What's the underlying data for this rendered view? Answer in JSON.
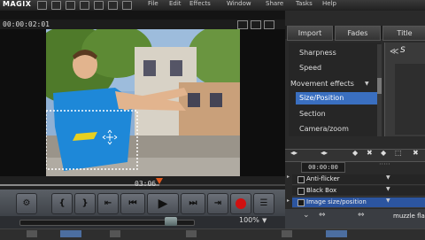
{
  "app": {
    "logo": "MAGIX"
  },
  "menu": [
    "File",
    "Edit",
    "Effects",
    "Window",
    "Share",
    "Tasks",
    "Help"
  ],
  "player": {
    "timecode": "00:00:02:01",
    "scrub_time": "03:06",
    "zoom": "100%",
    "progress": 0.56,
    "volume": 0.87
  },
  "transport": {
    "buttons": [
      "{",
      "}",
      "⇤",
      "⏮",
      "▶",
      "⏭",
      "⇥",
      "●",
      "☰"
    ]
  },
  "panel": {
    "tabs": [
      "Import",
      "Fades",
      "Title"
    ],
    "list": [
      "Sharpness",
      "Speed",
      "Movement effects",
      "Size/Position",
      "Section",
      "Camera/zoom"
    ],
    "selected": "Size/Position",
    "keyframe_time": "00:00:00",
    "effects": [
      {
        "label": "Anti-flicker",
        "selected": false
      },
      {
        "label": "Black Box",
        "selected": false
      },
      {
        "label": "Image size/position",
        "selected": true
      }
    ],
    "bottom_label": "muzzle flash"
  },
  "colors": {
    "accent": "#3a6fc0",
    "record": "#d01010",
    "playhead": "#e05a1e"
  }
}
